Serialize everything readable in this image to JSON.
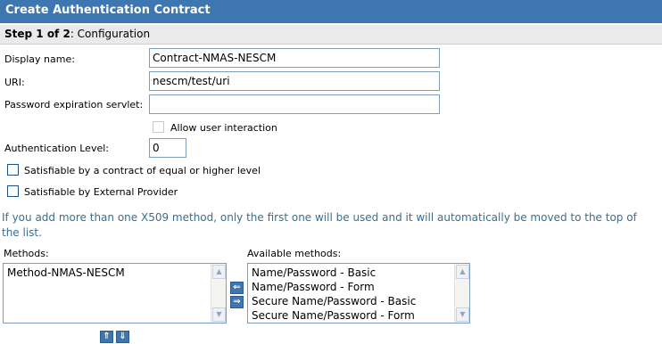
{
  "header": {
    "title": "Create Authentication Contract"
  },
  "step": {
    "number": "Step 1 of 2",
    "name": ": Configuration"
  },
  "form": {
    "display_name": {
      "label": "Display name:",
      "value": "Contract-NMAS-NESCM"
    },
    "uri": {
      "label": "URI:",
      "value": "nescm/test/uri"
    },
    "password_expiration": {
      "label": "Password expiration servlet:",
      "value": ""
    },
    "allow_user_interaction": {
      "label": "Allow user interaction",
      "checked": false,
      "disabled": true
    },
    "auth_level": {
      "label": "Authentication Level:",
      "value": "0"
    },
    "satisfiable_contract": {
      "label": "Satisfiable by a contract of equal or higher level",
      "checked": false
    },
    "satisfiable_external": {
      "label": "Satisfiable by External Provider",
      "checked": false
    }
  },
  "info": {
    "text": "If you add more than one X509 method, only the first one will be used and it will automatically be moved to the top of the list."
  },
  "methods": {
    "label": "Methods:",
    "items": [
      "Method-NMAS-NESCM"
    ]
  },
  "available": {
    "label": "Available methods:",
    "items": [
      "Name/Password - Basic",
      "Name/Password - Form",
      "Secure Name/Password - Basic",
      "Secure Name/Password - Form"
    ]
  },
  "colors": {
    "header_bg": "#3d76b0",
    "step_bg": "#eaeaea",
    "info_text": "#3a6e8f",
    "button_blue": "#3d76b0"
  },
  "icons": {
    "move_left": "arrow-left-icon",
    "move_right": "arrow-right-icon",
    "move_up": "arrow-up-icon",
    "move_down": "arrow-down-icon",
    "scroll_up": "scroll-up-icon",
    "scroll_down": "scroll-down-icon"
  }
}
